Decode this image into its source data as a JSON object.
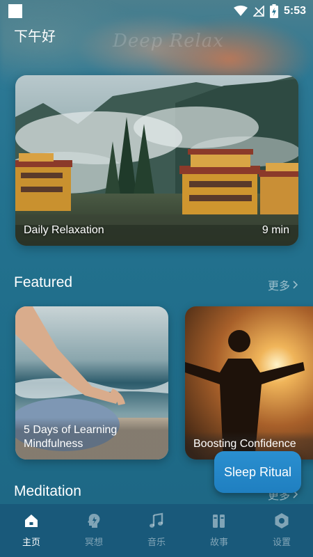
{
  "status_bar": {
    "time": "5:53"
  },
  "header": {
    "greeting": "下午好",
    "logo": "Deep Relax"
  },
  "hero": {
    "title": "Daily Relaxation",
    "duration": "9 min"
  },
  "featured": {
    "title": "Featured",
    "more_label": "更多",
    "cards": [
      {
        "title": "5 Days of Learning Mindfulness"
      },
      {
        "title": "Boosting Confidence"
      }
    ]
  },
  "meditation": {
    "title": "Meditation",
    "more_label": "更多"
  },
  "floating_button": {
    "label": "Sleep Ritual"
  },
  "bottom_nav": {
    "items": [
      {
        "label": "主页",
        "icon": "home-icon",
        "active": true
      },
      {
        "label": "冥想",
        "icon": "meditation-head-icon",
        "active": false
      },
      {
        "label": "音乐",
        "icon": "music-note-icon",
        "active": false
      },
      {
        "label": "故事",
        "icon": "books-icon",
        "active": false
      },
      {
        "label": "设置",
        "icon": "settings-icon",
        "active": false
      }
    ]
  },
  "colors": {
    "nav_background": "#19597a",
    "page_background": "#1f6c89",
    "sleep_button": "#2a8fd0"
  }
}
